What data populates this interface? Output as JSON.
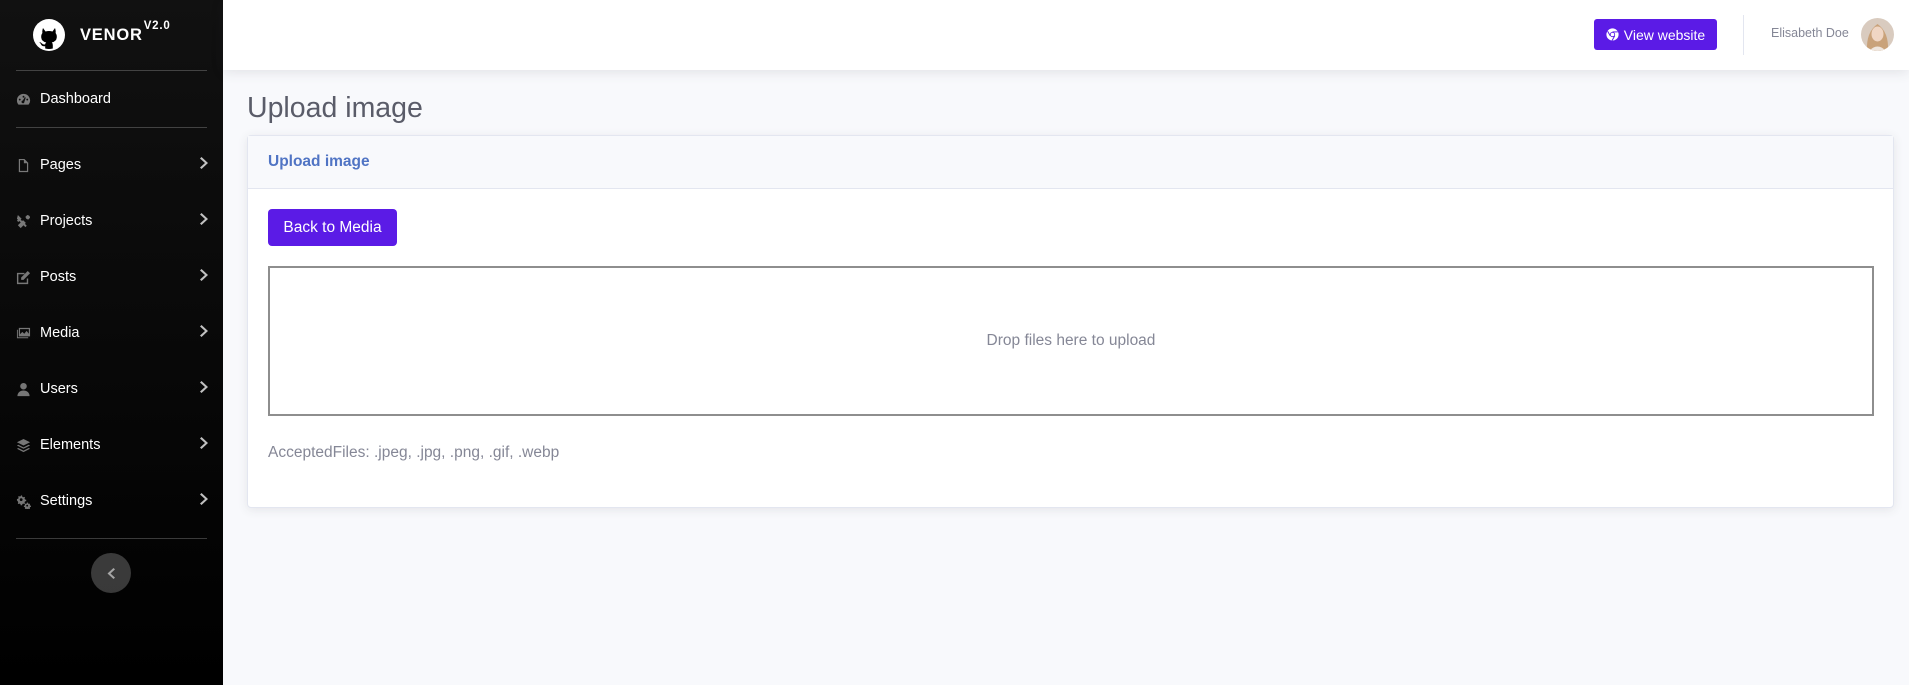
{
  "brand": {
    "name": "VENOR",
    "version": "V2.0"
  },
  "sidebar": {
    "dashboard": {
      "label": "Dashboard",
      "icon": "tachometer-icon"
    },
    "items": [
      {
        "label": "Pages",
        "icon": "file-icon"
      },
      {
        "label": "Projects",
        "icon": "tools-icon"
      },
      {
        "label": "Posts",
        "icon": "edit-icon"
      },
      {
        "label": "Media",
        "icon": "images-icon"
      },
      {
        "label": "Users",
        "icon": "user-icon"
      },
      {
        "label": "Elements",
        "icon": "layers-icon"
      },
      {
        "label": "Settings",
        "icon": "cogs-icon"
      }
    ]
  },
  "topbar": {
    "view_website_label": "View website",
    "user_name": "Elisabeth Doe"
  },
  "page": {
    "title": "Upload image",
    "card_title": "Upload image",
    "back_button_label": "Back to Media",
    "dropzone_text": "Drop files here to upload",
    "accepted_files": "AcceptedFiles: .jpeg, .jpg, .png, .gif, .webp"
  },
  "colors": {
    "accent": "#5b1be6",
    "sidebar_bg": "#000000",
    "card_title": "#5074c4"
  }
}
